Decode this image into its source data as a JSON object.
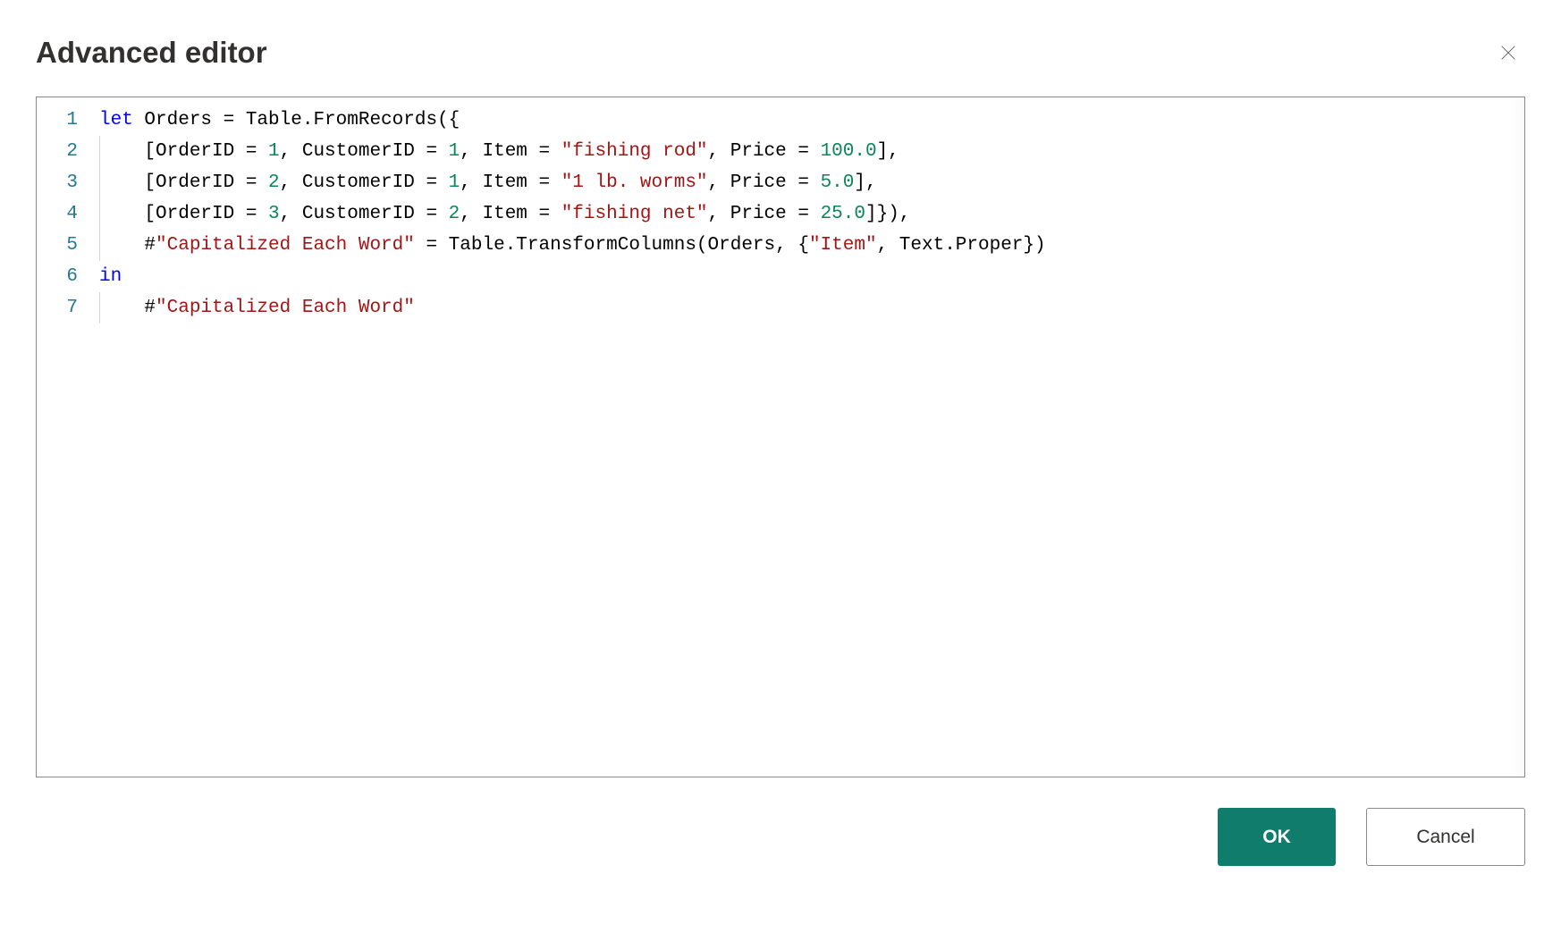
{
  "header": {
    "title": "Advanced editor"
  },
  "editor": {
    "lines": [
      {
        "num": "1",
        "indent": 0,
        "tokens": [
          {
            "t": "kw",
            "v": "let"
          },
          {
            "t": "txt",
            "v": " Orders = Table.FromRecords({"
          }
        ]
      },
      {
        "num": "2",
        "indent": 1,
        "tokens": [
          {
            "t": "txt",
            "v": "    [OrderID = "
          },
          {
            "t": "num",
            "v": "1"
          },
          {
            "t": "txt",
            "v": ", CustomerID = "
          },
          {
            "t": "num",
            "v": "1"
          },
          {
            "t": "txt",
            "v": ", Item = "
          },
          {
            "t": "str",
            "v": "\"fishing rod\""
          },
          {
            "t": "txt",
            "v": ", Price = "
          },
          {
            "t": "num",
            "v": "100.0"
          },
          {
            "t": "txt",
            "v": "],"
          }
        ]
      },
      {
        "num": "3",
        "indent": 1,
        "tokens": [
          {
            "t": "txt",
            "v": "    [OrderID = "
          },
          {
            "t": "num",
            "v": "2"
          },
          {
            "t": "txt",
            "v": ", CustomerID = "
          },
          {
            "t": "num",
            "v": "1"
          },
          {
            "t": "txt",
            "v": ", Item = "
          },
          {
            "t": "str",
            "v": "\"1 lb. worms\""
          },
          {
            "t": "txt",
            "v": ", Price = "
          },
          {
            "t": "num",
            "v": "5.0"
          },
          {
            "t": "txt",
            "v": "],"
          }
        ]
      },
      {
        "num": "4",
        "indent": 1,
        "tokens": [
          {
            "t": "txt",
            "v": "    [OrderID = "
          },
          {
            "t": "num",
            "v": "3"
          },
          {
            "t": "txt",
            "v": ", CustomerID = "
          },
          {
            "t": "num",
            "v": "2"
          },
          {
            "t": "txt",
            "v": ", Item = "
          },
          {
            "t": "str",
            "v": "\"fishing net\""
          },
          {
            "t": "txt",
            "v": ", Price = "
          },
          {
            "t": "num",
            "v": "25.0"
          },
          {
            "t": "txt",
            "v": "]}),"
          }
        ]
      },
      {
        "num": "5",
        "indent": 1,
        "tokens": [
          {
            "t": "txt",
            "v": "    #"
          },
          {
            "t": "str",
            "v": "\"Capitalized Each Word\""
          },
          {
            "t": "txt",
            "v": " = Table.TransformColumns(Orders, {"
          },
          {
            "t": "str",
            "v": "\"Item\""
          },
          {
            "t": "txt",
            "v": ", Text.Proper})"
          }
        ]
      },
      {
        "num": "6",
        "indent": 0,
        "tokens": [
          {
            "t": "kw",
            "v": "in"
          }
        ]
      },
      {
        "num": "7",
        "indent": 1,
        "tokens": [
          {
            "t": "txt",
            "v": "    #"
          },
          {
            "t": "str",
            "v": "\"Capitalized Each Word\""
          }
        ]
      }
    ]
  },
  "buttons": {
    "ok": "OK",
    "cancel": "Cancel"
  }
}
